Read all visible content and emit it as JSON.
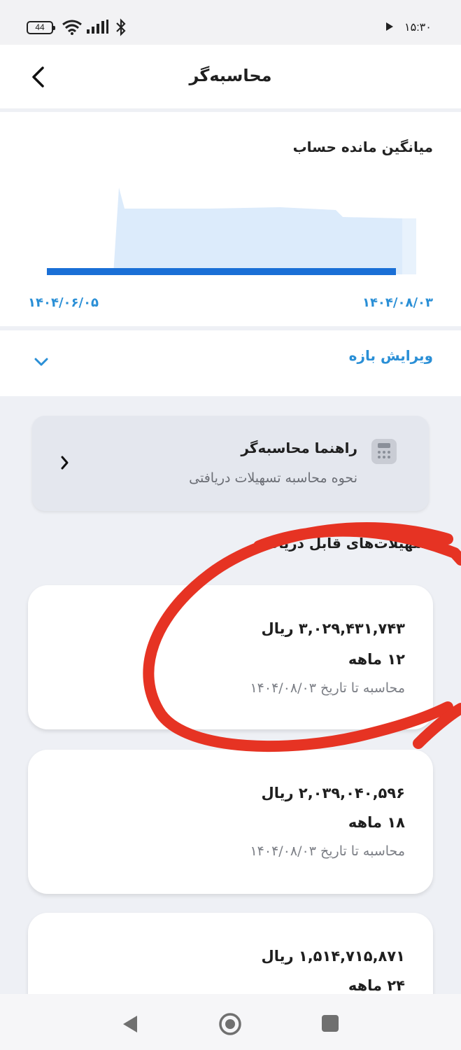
{
  "status_bar": {
    "battery": "44",
    "time": "۱۵:۳۰",
    "icons": [
      "battery-icon",
      "wifi-icon",
      "signal-icon",
      "bluetooth-icon",
      "play-icon"
    ]
  },
  "header": {
    "title": "محاسبه‌گر",
    "back_icon": "chevron-left-icon"
  },
  "chart": {
    "title": "میانگین مانده حساب",
    "start_date": "۱۴۰۴/۰۶/۰۵",
    "end_date": "۱۴۰۴/۰۸/۰۳",
    "area_color": "#dcebfb",
    "bar_color": "#1a6fd6"
  },
  "range": {
    "label": "ویرایش بازه",
    "icon": "chevron-down-icon"
  },
  "guide": {
    "title": "راهنما محاسبه‌گر",
    "subtitle": "نحوه محاسبه تسهیلات دریافتی",
    "icon": "calculator-icon"
  },
  "loans_section": {
    "title": "تسهیلات‌های قابل دریافت",
    "items": [
      {
        "amount": "۳,۰۲۹,۴۳۱,۷۴۳ ریال",
        "term": "۱۲ ماهه",
        "calc_date": "محاسبه تا تاریخ ۱۴۰۴/۰۸/۰۳"
      },
      {
        "amount": "۲,۰۳۹,۰۴۰,۵۹۶ ریال",
        "term": "۱۸ ماهه",
        "calc_date": "محاسبه تا تاریخ ۱۴۰۴/۰۸/۰۳"
      },
      {
        "amount": "۱,۵۱۴,۷۱۵,۸۷۱ ریال",
        "term": "۲۴ ماهه",
        "calc_date": ""
      }
    ]
  },
  "annotation_color": "#e63323",
  "nav_bar": {
    "icons": [
      "nav-back-icon",
      "nav-home-icon",
      "nav-recents-icon"
    ]
  }
}
